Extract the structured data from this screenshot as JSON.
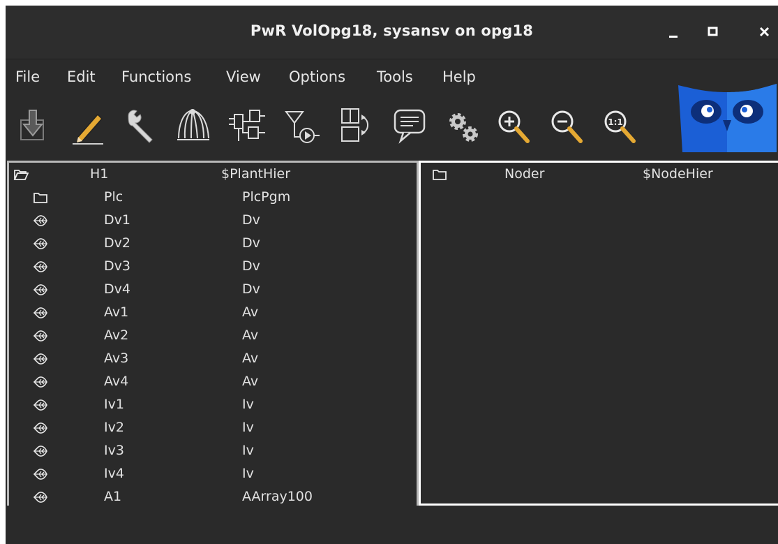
{
  "window": {
    "title": "PwR VolOpg18,  sysansv on opg18",
    "controls": [
      "minimize",
      "maximize",
      "close"
    ]
  },
  "menu": [
    "File",
    "Edit",
    "Functions",
    "View",
    "Options",
    "Tools",
    "Help"
  ],
  "toolbar": [
    {
      "name": "import-icon"
    },
    {
      "name": "edit-pencil-icon"
    },
    {
      "name": "wrench-icon"
    },
    {
      "name": "plant-hierarchy-icon"
    },
    {
      "name": "plc-program-icon"
    },
    {
      "name": "trace-icon"
    },
    {
      "name": "io-config-icon"
    },
    {
      "name": "message-icon"
    },
    {
      "name": "settings-gears-icon"
    },
    {
      "name": "zoom-in-icon"
    },
    {
      "name": "zoom-out-icon"
    },
    {
      "name": "zoom-reset-icon"
    }
  ],
  "plant_tree": {
    "rows": [
      {
        "icon": "folder-open-icon",
        "name": "H1",
        "class": "$PlantHier",
        "level": 0
      },
      {
        "icon": "folder-icon",
        "name": "Plc",
        "class": "PlcPgm",
        "level": 1
      },
      {
        "icon": "leaf-icon",
        "name": "Dv1",
        "class": "Dv",
        "level": 1
      },
      {
        "icon": "leaf-icon",
        "name": "Dv2",
        "class": "Dv",
        "level": 1
      },
      {
        "icon": "leaf-icon",
        "name": "Dv3",
        "class": "Dv",
        "level": 1
      },
      {
        "icon": "leaf-icon",
        "name": "Dv4",
        "class": "Dv",
        "level": 1
      },
      {
        "icon": "leaf-icon",
        "name": "Av1",
        "class": "Av",
        "level": 1
      },
      {
        "icon": "leaf-icon",
        "name": "Av2",
        "class": "Av",
        "level": 1
      },
      {
        "icon": "leaf-icon",
        "name": "Av3",
        "class": "Av",
        "level": 1
      },
      {
        "icon": "leaf-icon",
        "name": "Av4",
        "class": "Av",
        "level": 1
      },
      {
        "icon": "leaf-icon",
        "name": "Iv1",
        "class": "Iv",
        "level": 1
      },
      {
        "icon": "leaf-icon",
        "name": "Iv2",
        "class": "Iv",
        "level": 1
      },
      {
        "icon": "leaf-icon",
        "name": "Iv3",
        "class": "Iv",
        "level": 1
      },
      {
        "icon": "leaf-icon",
        "name": "Iv4",
        "class": "Iv",
        "level": 1
      },
      {
        "icon": "leaf-icon",
        "name": "A1",
        "class": "AArray100",
        "level": 1
      }
    ]
  },
  "node_tree": {
    "rows": [
      {
        "icon": "folder-icon",
        "name": "Noder",
        "class": "$NodeHier",
        "level": 0
      }
    ]
  },
  "colors": {
    "background": "#2a2a2a",
    "titlebar": "#2d2d2d",
    "text": "#e2e2e2",
    "left_panel_border": "#b8b8b8",
    "right_panel_border": "#ffffff",
    "owl_blue": "#1b5fd6"
  }
}
